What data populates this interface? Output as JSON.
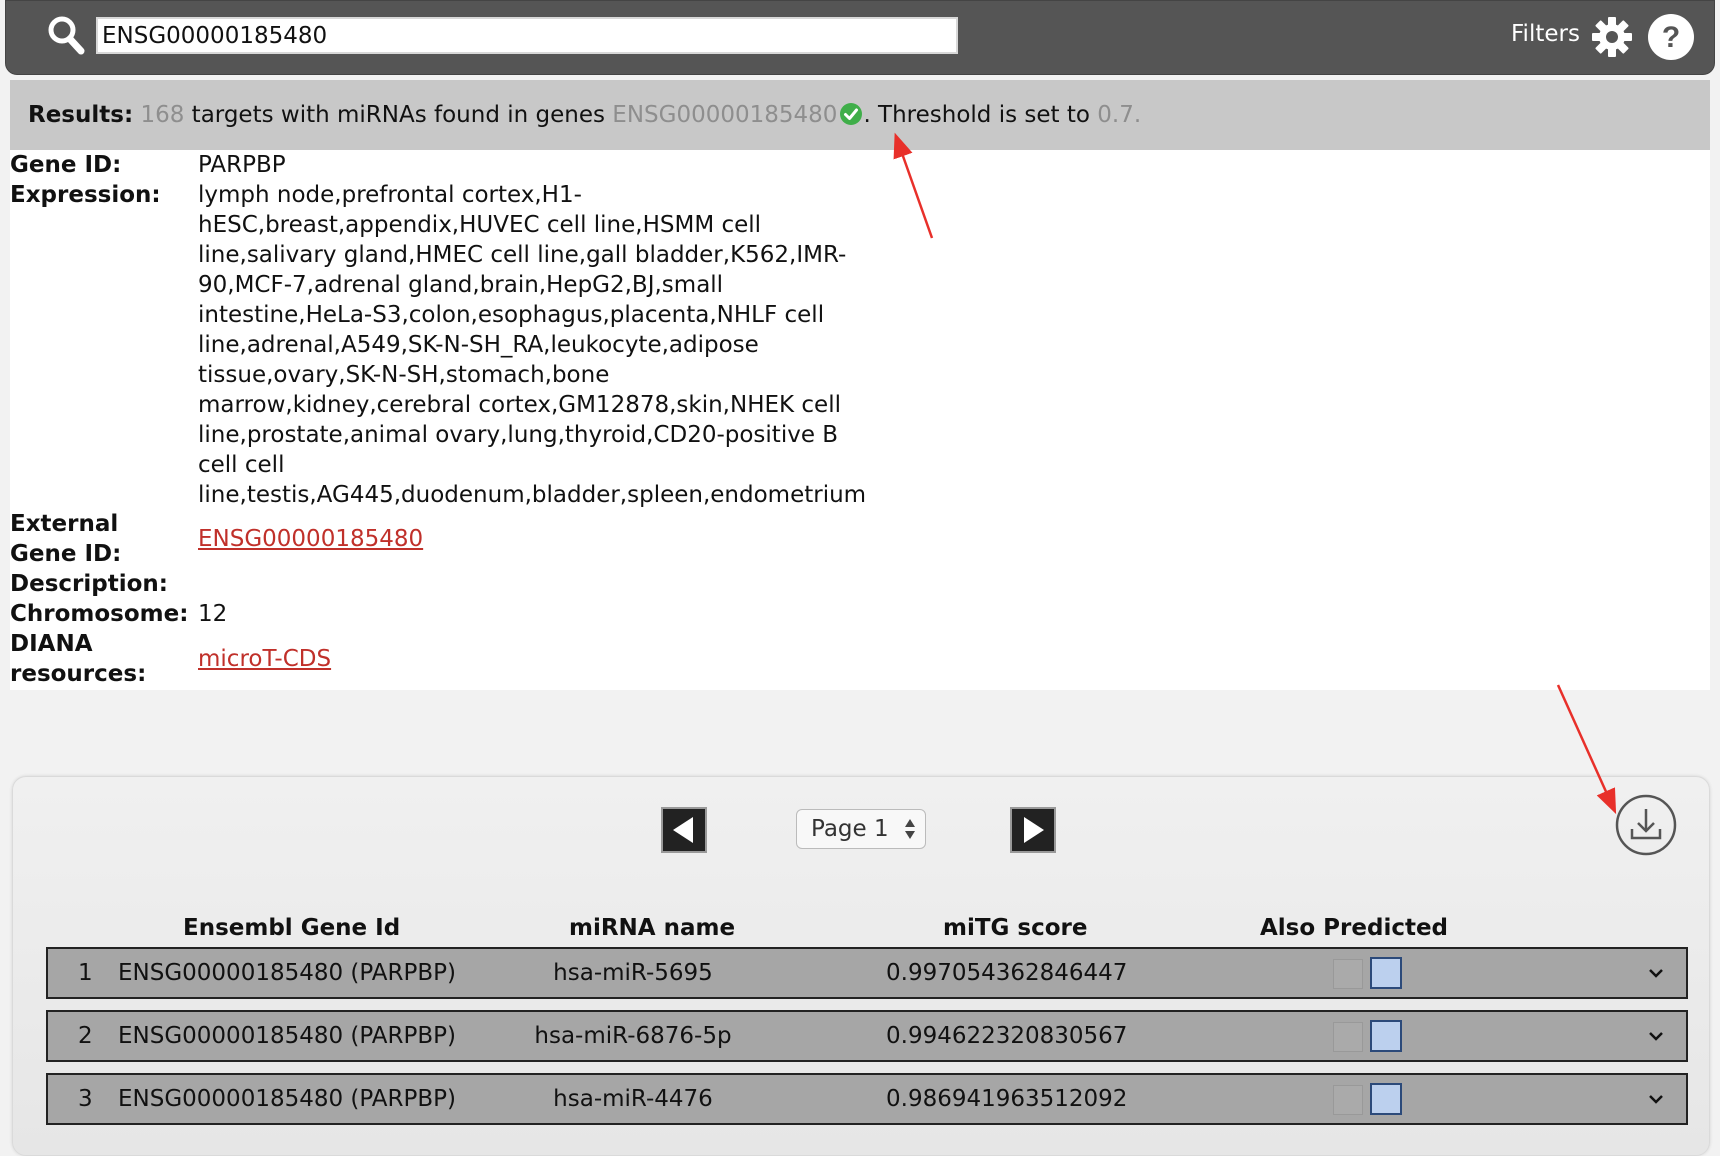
{
  "search": {
    "value": "ENSG00000185480",
    "filters_label": "Filters"
  },
  "results": {
    "label": "Results:",
    "count": "168",
    "text_targets": " targets with miRNAs found in genes ",
    "gene_query": "ENSG00000185480",
    "text_threshold": ". Threshold is set to ",
    "threshold": "0.7."
  },
  "gene_info": {
    "gene_id_label": "Gene ID:",
    "gene_id": "PARPBP",
    "expression_label": "Expression:",
    "expression": "lymph node,prefrontal cortex,H1-hESC,breast,appendix,HUVEC cell line,HSMM cell line,salivary gland,HMEC cell line,gall bladder,K562,IMR-90,MCF-7,adrenal gland,brain,HepG2,BJ,small intestine,HeLa-S3,colon,esophagus,placenta,NHLF cell line,adrenal,A549,SK-N-SH_RA,leukocyte,adipose tissue,ovary,SK-N-SH,stomach,bone marrow,kidney,cerebral cortex,GM12878,skin,NHEK cell line,prostate,animal ovary,lung,thyroid,CD20-positive B cell cell line,testis,AG445,duodenum,bladder,spleen,endometrium",
    "expression_lines": [
      "lymph node,prefrontal cortex,H1-",
      "hESC,breast,appendix,HUVEC cell line,HSMM cell",
      "line,salivary gland,HMEC cell line,gall bladder,K562,IMR-",
      "90,MCF-7,adrenal gland,brain,HepG2,BJ,small",
      "intestine,HeLa-S3,colon,esophagus,placenta,NHLF cell",
      "line,adrenal,A549,SK-N-SH_RA,leukocyte,adipose",
      "tissue,ovary,SK-N-SH,stomach,bone",
      "marrow,kidney,cerebral cortex,GM12878,skin,NHEK cell",
      "line,prostate,animal ovary,lung,thyroid,CD20-positive B",
      "cell cell",
      "line,testis,AG445,duodenum,bladder,spleen,endometrium"
    ],
    "external_label_1": "External",
    "external_label_2": "Gene ID:",
    "external_id": "ENSG00000185480",
    "description_label": "Description:",
    "description": "",
    "chromosome_label": "Chromosome:",
    "chromosome": "12",
    "diana_label_1": "DIANA",
    "diana_label_2": "resources:",
    "diana_link": "microT-CDS"
  },
  "pager": {
    "page_label": "Page 1"
  },
  "table": {
    "headers": [
      "Ensembl Gene Id",
      "miRNA name",
      "miTG score",
      "Also Predicted"
    ],
    "rows": [
      {
        "num": "1",
        "gene": "ENSG00000185480 (PARPBP)",
        "mirna": "hsa-miR-5695",
        "score": "0.997054362846447"
      },
      {
        "num": "2",
        "gene": "ENSG00000185480 (PARPBP)",
        "mirna": "hsa-miR-6876-5p",
        "score": "0.994622320830567"
      },
      {
        "num": "3",
        "gene": "ENSG00000185480 (PARPBP)",
        "mirna": "hsa-miR-4476",
        "score": "0.986941963512092"
      }
    ]
  },
  "colors": {
    "topbar": "#555555",
    "results_bar": "#c8c8c8",
    "link": "#c0302a",
    "check_green": "#3fae49",
    "annotation_arrow": "#e8302a",
    "row_bg": "#a6a6a6"
  },
  "icons": [
    "search-icon",
    "gear-icon",
    "help-icon",
    "check-icon",
    "prev-arrow-icon",
    "next-arrow-icon",
    "download-icon",
    "chevron-down-icon"
  ]
}
